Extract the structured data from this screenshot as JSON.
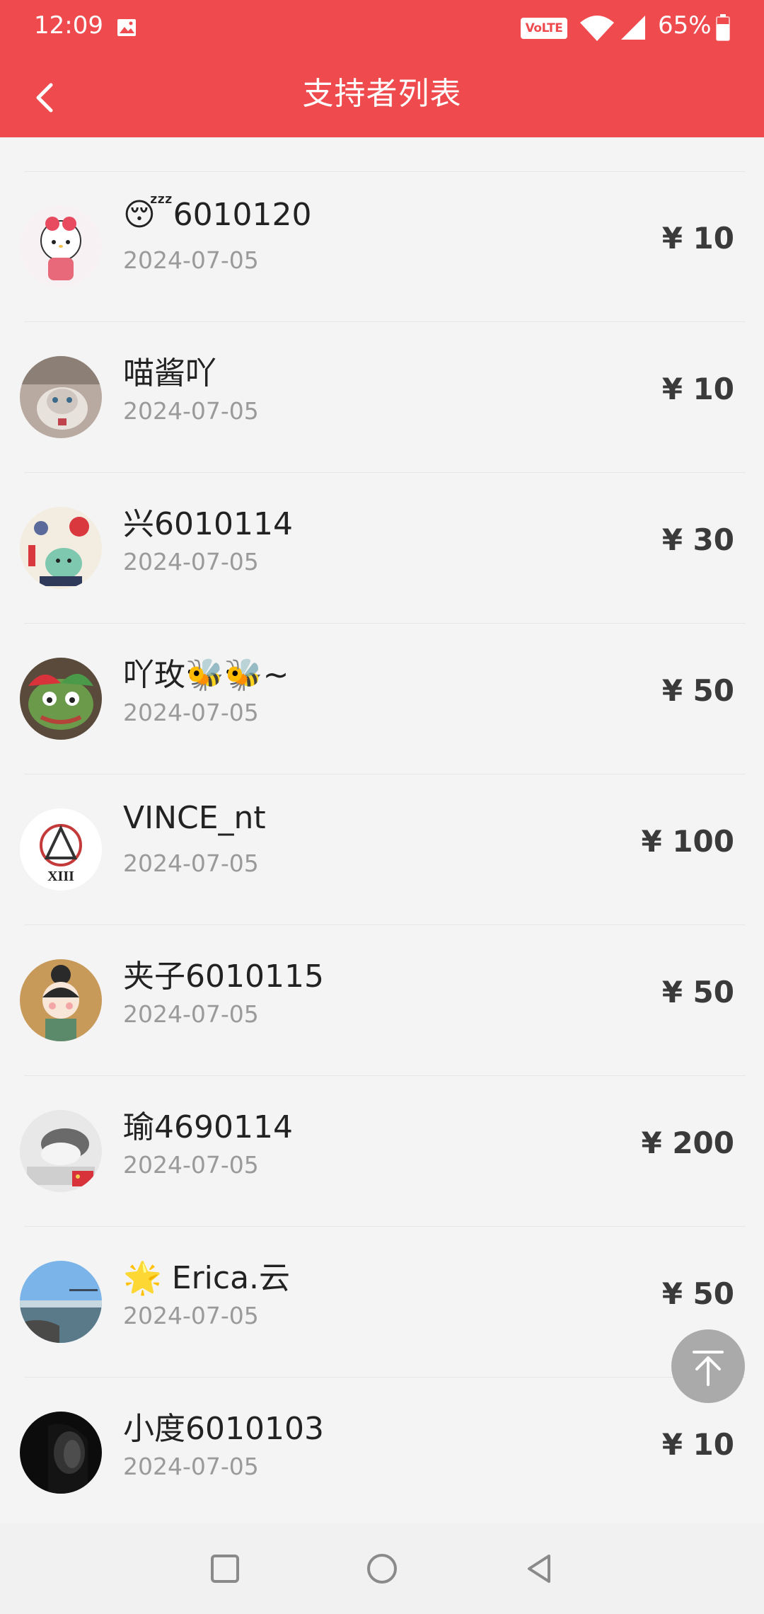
{
  "status_bar": {
    "time": "12:09",
    "volte": "VoLTE",
    "battery": "65%"
  },
  "header": {
    "title": "支持者列表"
  },
  "supporters": [
    {
      "name": "😴6010120",
      "date": "2024-07-05",
      "amount": "¥ 10"
    },
    {
      "name": "喵酱吖",
      "date": "2024-07-05",
      "amount": "¥ 10"
    },
    {
      "name": "兴6010114",
      "date": "2024-07-05",
      "amount": "¥ 30"
    },
    {
      "name": "吖玫🐝🐝~",
      "date": "2024-07-05",
      "amount": "¥ 50"
    },
    {
      "name": "VINCE_nt",
      "date": "2024-07-05",
      "amount": "¥ 100"
    },
    {
      "name": "夹子6010115",
      "date": "2024-07-05",
      "amount": "¥ 50"
    },
    {
      "name": "瑜4690114",
      "date": "2024-07-05",
      "amount": "¥ 200"
    },
    {
      "name": "🌟 Erica.云",
      "date": "2024-07-05",
      "amount": "¥ 50"
    },
    {
      "name": "小度6010103",
      "date": "2024-07-05",
      "amount": "¥ 10"
    }
  ],
  "colors": {
    "brand": "#ef4b4e",
    "background": "#f4f4f4",
    "amount": "#3a3a3a",
    "date": "#9a9a9a"
  },
  "icons": {
    "back": "chevron-left-icon",
    "scroll_top": "arrow-up-to-top-icon",
    "nav_recents": "square-icon",
    "nav_home": "circle-icon",
    "nav_back": "triangle-back-icon"
  }
}
